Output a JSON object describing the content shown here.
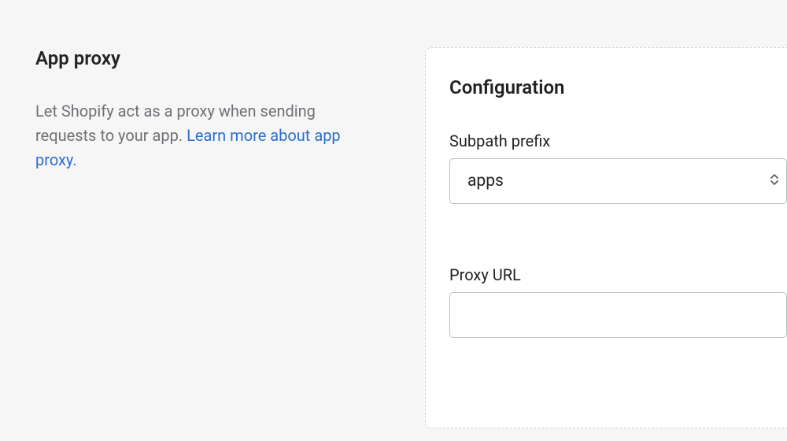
{
  "left": {
    "title": "App proxy",
    "description_before": "Let Shopify act as a proxy when sending requests to your app. ",
    "link_text": "Learn more about app proxy."
  },
  "right": {
    "title": "Configuration",
    "subpath_prefix_label": "Subpath prefix",
    "subpath_prefix_value": "apps",
    "proxy_url_label": "Proxy URL",
    "proxy_url_value": ""
  }
}
